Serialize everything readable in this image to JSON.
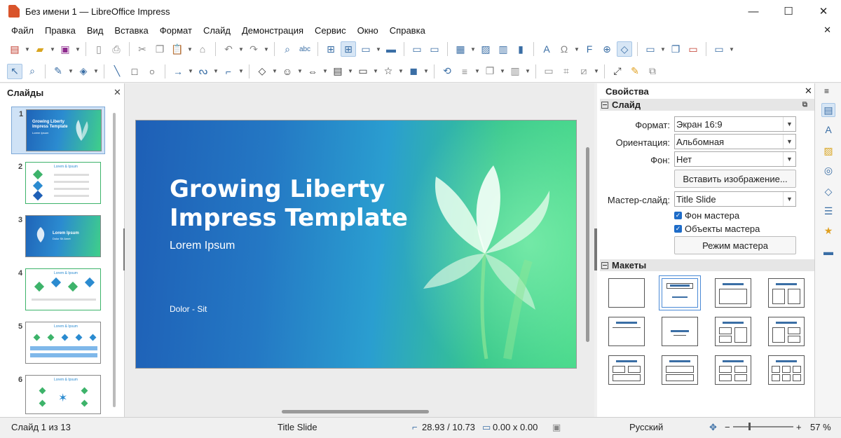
{
  "window": {
    "title": "Без имени 1 — LibreOffice Impress",
    "minimize": "—",
    "maximize": "☐",
    "close": "✕"
  },
  "menu": [
    "Файл",
    "Правка",
    "Вид",
    "Вставка",
    "Формат",
    "Слайд",
    "Демонстрация",
    "Сервис",
    "Окно",
    "Справка"
  ],
  "menu_close": "✕",
  "slides_pane": {
    "title": "Слайды",
    "close": "✕",
    "thumbnails": [
      {
        "num": "1",
        "title": "Growing Liberty\nImpress Template",
        "sub": "Lorem Ipsum"
      },
      {
        "num": "2",
        "title": "Lorem & Ipsum"
      },
      {
        "num": "3",
        "title": "Lorem Ipsum",
        "sub": "Dolor Sit Amet"
      },
      {
        "num": "4",
        "title": "Lorem & Ipsum"
      },
      {
        "num": "5",
        "title": "Lorem & Ipsum"
      },
      {
        "num": "6",
        "title": "Lorem & Ipsum"
      }
    ]
  },
  "slide": {
    "title": "Growing Liberty\nImpress Template",
    "subtitle": "Lorem Ipsum",
    "footer": "Dolor - Sit",
    "colors": {
      "start": "#1e5fb6",
      "end": "#47d98a"
    }
  },
  "properties": {
    "title": "Свойства",
    "close": "✕",
    "menu": "≡",
    "slide_section": "Слайд",
    "format_label": "Формат:",
    "format_value": "Экран 16:9",
    "orientation_label": "Ориентация:",
    "orientation_value": "Альбомная",
    "background_label": "Фон:",
    "background_value": "Нет",
    "insert_image_button": "Вставить изображение...",
    "master_slide_label": "Мастер-слайд:",
    "master_slide_value": "Title Slide",
    "master_background_check": "Фон мастера",
    "master_objects_check": "Объекты мастера",
    "master_mode_button": "Режим мастера",
    "layouts_section": "Макеты"
  },
  "status": {
    "slide_count": "Слайд 1 из 13",
    "master_name": "Title Slide",
    "position": "28.93 / 10.73",
    "size": "0.00 x 0.00",
    "language": "Русский",
    "zoom": "57 %",
    "zoom_minus": "−",
    "zoom_plus": "+"
  },
  "icons": {
    "toolbar1": [
      "new-icon",
      "open-icon",
      "save-icon",
      "export-pdf-icon",
      "print-icon",
      "cut-icon",
      "copy-icon",
      "paste-icon",
      "clone-format-icon",
      "undo-icon",
      "redo-icon",
      "find-replace-icon",
      "spellcheck-icon",
      "grid-icon",
      "snap-grid-icon",
      "display-views-icon",
      "master-slide-icon",
      "start-first-icon",
      "start-current-icon",
      "table-icon",
      "image-icon",
      "media-icon",
      "chart-icon",
      "textbox-icon",
      "special-char-icon",
      "fontwork-icon",
      "hyperlink-icon",
      "show-draw-functions-icon",
      "new-slide-icon",
      "duplicate-slide-icon",
      "delete-slide-icon",
      "slide-layout-icon"
    ],
    "toolbar2": [
      "select-icon",
      "zoom-icon",
      "line-color-icon",
      "fill-color-icon",
      "line-icon",
      "rectangle-icon",
      "ellipse-icon",
      "arrow-icon",
      "curve-icon",
      "connector-icon",
      "basic-shapes-icon",
      "symbol-shapes-icon",
      "block-arrows-icon",
      "flowchart-icon",
      "callouts-icon",
      "stars-icon",
      "3d-objects-icon",
      "rotate-icon",
      "align-icon",
      "arrange-icon",
      "distribute-icon",
      "shadow-icon",
      "crop-icon",
      "filter-icon",
      "points-icon",
      "glue-icon",
      "toggle-extrusion-icon"
    ]
  }
}
